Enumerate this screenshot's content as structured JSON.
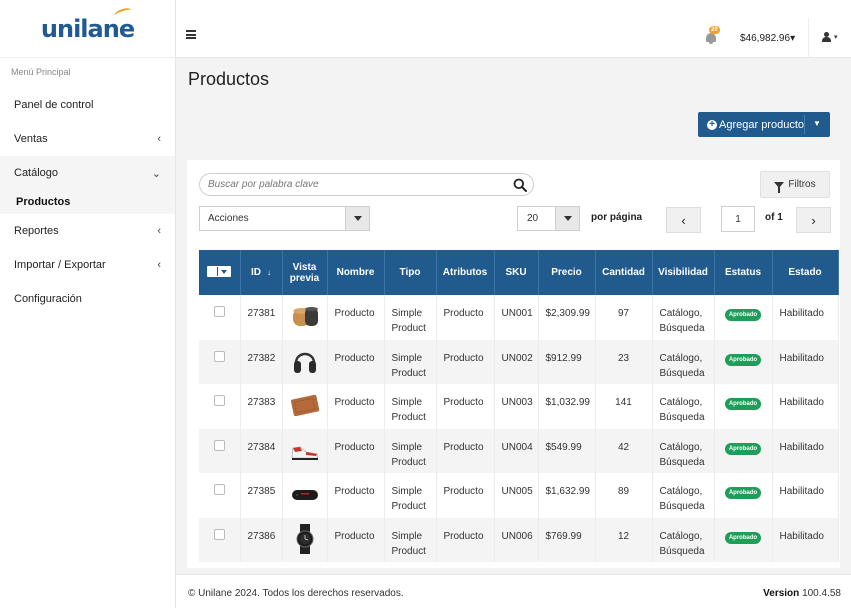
{
  "brand": {
    "logo_text": "unilane",
    "accent": "#e8a025",
    "primary": "#215a8d"
  },
  "sidebar": {
    "section_title": "Menú Principal",
    "items": [
      {
        "label": "Panel de control",
        "chevron": ""
      },
      {
        "label": "Ventas",
        "chevron": "‹"
      },
      {
        "label": "Catálogo",
        "chevron": "⌄"
      },
      {
        "label": "Reportes",
        "chevron": "‹"
      },
      {
        "label": "Importar / Exportar",
        "chevron": "‹"
      },
      {
        "label": "Configuración",
        "chevron": ""
      }
    ],
    "catalog_sub": "Productos"
  },
  "topbar": {
    "notification_count": "20",
    "balance": "$46,982.96",
    "balance_caret": "▾",
    "user_caret": "▾"
  },
  "main": {
    "title": "Productos",
    "add_button": "Agregar producto",
    "search_placeholder": "Buscar por palabra clave",
    "filters_button": "Filtros",
    "actions_select": "Acciones",
    "per_page_value": "20",
    "per_page_label": "por página",
    "page_prev": "‹",
    "page_next": "›",
    "page_current": "1",
    "page_of": "of 1"
  },
  "table": {
    "headers": [
      "",
      "ID",
      "Vista previa",
      "Nombre",
      "Tipo",
      "Atributos",
      "SKU",
      "Precio",
      "Cantidad",
      "Visibilidad",
      "Estatus",
      "Estado"
    ],
    "sort_arrow": "↓",
    "rows": [
      {
        "id": "27381",
        "thumb": "wood-jar",
        "name": "Producto",
        "type": "Simple Product",
        "attrs": "Producto",
        "sku": "UN001",
        "price": "$2,309.99",
        "qty": "97",
        "visibility": "Catálogo, Búsqueda",
        "status": "Aprobado",
        "state": "Habilitado"
      },
      {
        "id": "27382",
        "thumb": "headphones",
        "name": "Producto",
        "type": "Simple Product",
        "attrs": "Producto",
        "sku": "UN002",
        "price": "$912.99",
        "qty": "23",
        "visibility": "Catálogo, Búsqueda",
        "status": "Aprobado",
        "state": "Habilitado"
      },
      {
        "id": "27383",
        "thumb": "leather-wallet",
        "name": "Producto",
        "type": "Simple Product",
        "attrs": "Producto",
        "sku": "UN003",
        "price": "$1,032.99",
        "qty": "141",
        "visibility": "Catálogo, Búsqueda",
        "status": "Aprobado",
        "state": "Habilitado"
      },
      {
        "id": "27384",
        "thumb": "sneaker",
        "name": "Producto",
        "type": "Simple Product",
        "attrs": "Producto",
        "sku": "UN004",
        "price": "$549.99",
        "qty": "42",
        "visibility": "Catálogo, Búsqueda",
        "status": "Aprobado",
        "state": "Habilitado"
      },
      {
        "id": "27385",
        "thumb": "speaker",
        "name": "Producto",
        "type": "Simple Product",
        "attrs": "Producto",
        "sku": "UN005",
        "price": "$1,632.99",
        "qty": "89",
        "visibility": "Catálogo, Búsqueda",
        "status": "Aprobado",
        "state": "Habilitado"
      },
      {
        "id": "27386",
        "thumb": "watch",
        "name": "Producto",
        "type": "Simple Product",
        "attrs": "Producto",
        "sku": "UN006",
        "price": "$769.99",
        "qty": "12",
        "visibility": "Catálogo, Búsqueda",
        "status": "Aprobado",
        "state": "Habilitado"
      }
    ]
  },
  "footer": {
    "copyright": "© Unilane 2024. Todos los derechos reservados.",
    "version_label": "Version",
    "version_value": "100.4.58"
  }
}
